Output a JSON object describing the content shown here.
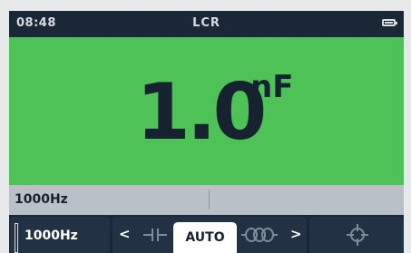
{
  "status_bar": {
    "time": "08:48",
    "mode": "LCR",
    "battery_icon": "battery-icon"
  },
  "reading": {
    "value": "1.0",
    "unit": "nF"
  },
  "info_bar": {
    "frequency": "1000Hz"
  },
  "softkeys": {
    "frequency_label": "1000Hz",
    "component_mode_label": "AUTO",
    "left_arrow": "<",
    "right_arrow": ">",
    "capacitor_icon": "capacitor-icon",
    "inductor_icon": "inductor-icon",
    "target_icon": "crosshair-icon"
  },
  "colors": {
    "reading_background": "#4fc257",
    "screen_background": "#1a2736",
    "info_bar_background": "#b9c0c8"
  }
}
